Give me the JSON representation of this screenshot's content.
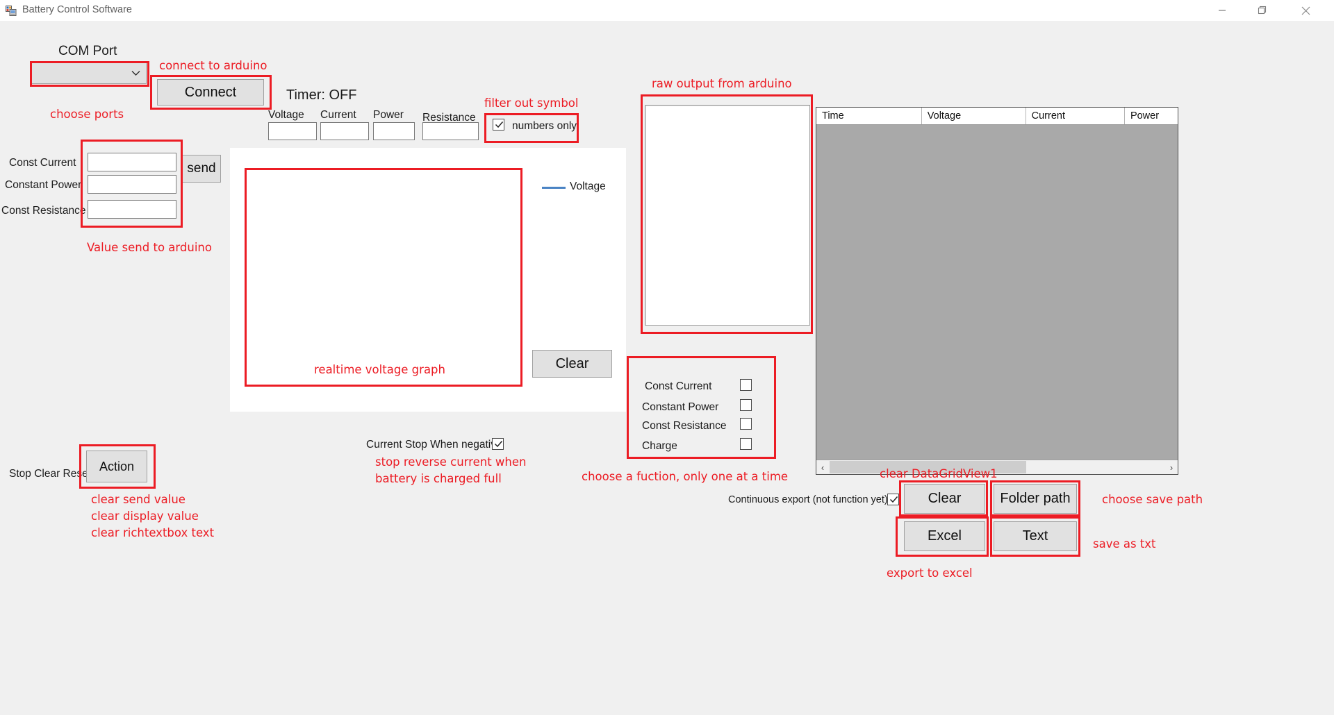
{
  "window": {
    "title": "Battery Control Software",
    "minimize_label": "minimize",
    "maximize_label": "maximize",
    "close_label": "close"
  },
  "com": {
    "label": "COM Port",
    "selected": "",
    "connect_label": "Connect",
    "annotation_choose_ports": "choose ports",
    "annotation_connect": "connect to arduino"
  },
  "timer": {
    "label": "Timer: OFF"
  },
  "readouts": {
    "fields": [
      {
        "label": "Voltage",
        "value": ""
      },
      {
        "label": "Current",
        "value": ""
      },
      {
        "label": "Power",
        "value": ""
      },
      {
        "label": "Resistance",
        "value": ""
      }
    ]
  },
  "numbers_only": {
    "label": "numbers only",
    "checked": true,
    "annotation": "filter out symbol"
  },
  "send_group": {
    "rows": [
      {
        "label": "Const Current",
        "value": ""
      },
      {
        "label": "Constant Power",
        "value": ""
      },
      {
        "label": "Const Resistance",
        "value": ""
      }
    ],
    "send_label": "send",
    "annotation": "Value send to arduino"
  },
  "chart": {
    "legend_label": "Voltage",
    "legend_color": "#4a83c4",
    "clear_label": "Clear",
    "annotation": "realtime voltage graph"
  },
  "raw_output": {
    "annotation": "raw output from arduino",
    "content": ""
  },
  "function_group": {
    "items": [
      {
        "label": "Const Current",
        "checked": false
      },
      {
        "label": "Constant Power",
        "checked": false
      },
      {
        "label": "Const Resistance",
        "checked": false
      },
      {
        "label": "Charge",
        "checked": false
      }
    ],
    "annotation": "choose a fuction, only one at a time"
  },
  "current_stop": {
    "label": "Current Stop When negative",
    "checked": true,
    "annotation_line1": "stop reverse current when",
    "annotation_line2": "battery is charged full"
  },
  "action": {
    "prefix_label": "Stop Clear Reset",
    "button_label": "Action",
    "annotation_line1": "clear send value",
    "annotation_line2": "clear display value",
    "annotation_line3": "clear richtextbox text"
  },
  "export": {
    "continuous_label": "Continuous export (not function yet)",
    "continuous_checked": true,
    "clear_label": "Clear",
    "folder_label": "Folder path",
    "excel_label": "Excel",
    "text_label": "Text",
    "annotation_clear_grid": "clear DataGridView1",
    "annotation_folder": "choose save path",
    "annotation_text": "save as txt",
    "annotation_excel": "export to excel"
  },
  "datagrid": {
    "columns": [
      "Time",
      "Voltage",
      "Current",
      "Power"
    ],
    "rows": [],
    "scroll_left_label": "‹",
    "scroll_right_label": "›"
  }
}
